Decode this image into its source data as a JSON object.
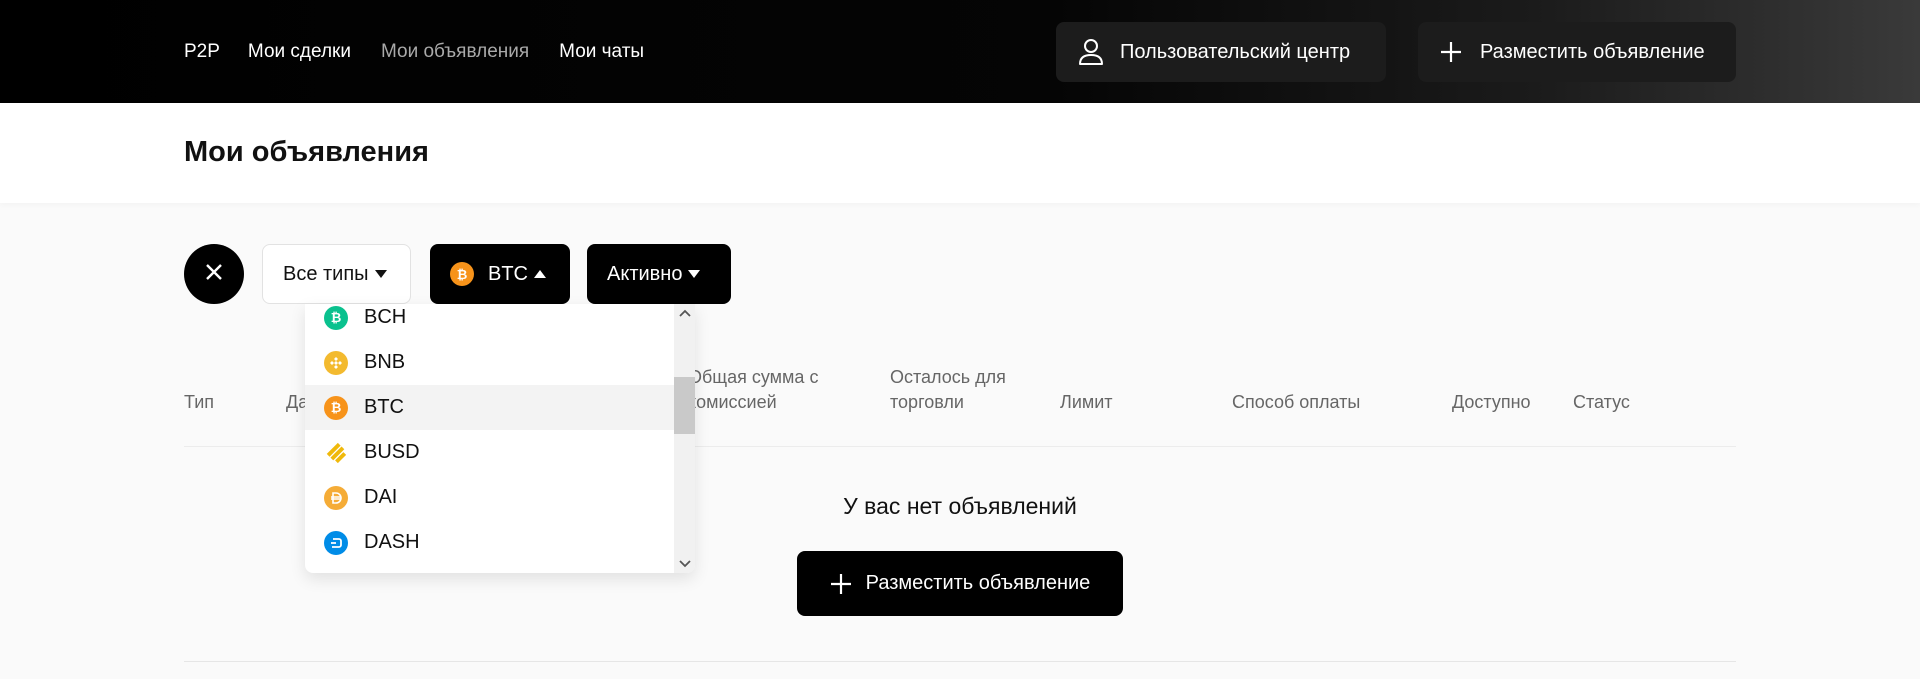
{
  "nav": {
    "items": [
      {
        "label": "P2P"
      },
      {
        "label": "Мои сделки"
      },
      {
        "label": "Мои объявления"
      },
      {
        "label": "Мои чаты"
      }
    ],
    "user_center_label": "Пользовательский центр",
    "post_ad_label": "Разместить объявление"
  },
  "page": {
    "title": "Мои объявления"
  },
  "filters": {
    "types_label": "Все типы",
    "coin_label": "BTC",
    "status_label": "Активно"
  },
  "table": {
    "columns": [
      "Тип",
      "Да",
      "Общая сумма с комиссией",
      "Осталось для торговли",
      "Лимит",
      "Способ оплаты",
      "Доступно",
      "Статус"
    ]
  },
  "empty_state": {
    "message": "У вас нет объявлений",
    "button_label": "Разместить объявление"
  },
  "dropdown": {
    "options": [
      {
        "label": "BCH",
        "icon": "bitcoin-cash-icon",
        "color": "#0ac18e"
      },
      {
        "label": "BNB",
        "icon": "bnb-icon",
        "color": "#f3ba2f"
      },
      {
        "label": "BTC",
        "icon": "bitcoin-icon",
        "color": "#f7931a",
        "selected": true
      },
      {
        "label": "BUSD",
        "icon": "busd-icon",
        "color": "#f0b90b"
      },
      {
        "label": "DAI",
        "icon": "dai-icon",
        "color": "#f5ac37"
      },
      {
        "label": "DASH",
        "icon": "dash-icon",
        "color": "#008ce7"
      }
    ]
  }
}
